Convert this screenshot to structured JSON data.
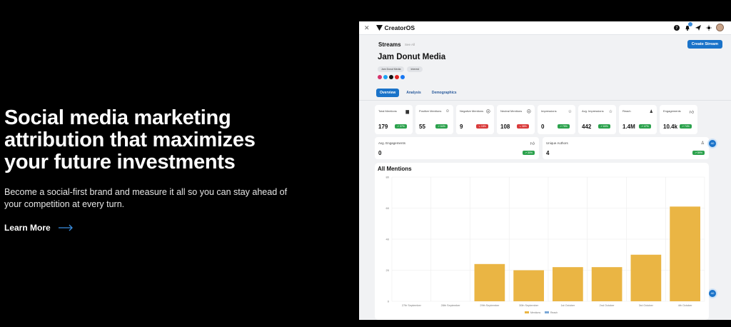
{
  "hero": {
    "headline": "Social media marketing attribution that maximizes your future investments",
    "subtext": "Become a social-first brand and measure it all so you can stay ahead of your competition at every turn.",
    "cta": "Learn More"
  },
  "app": {
    "brand": "CreatorOS",
    "section": "Streams",
    "see_all": "See All",
    "create_button": "Create Stream",
    "stream_name": "Jam Donut Media",
    "tags": [
      "Jam Donut Media",
      "Interest"
    ],
    "tabs": [
      "Overview",
      "Analysis",
      "Demographics"
    ],
    "active_tab": "Overview",
    "metrics": [
      {
        "label": "Total Mentions",
        "value": "179",
        "change": "37%",
        "trend": "up",
        "icon": "chat-icon"
      },
      {
        "label": "Positive Mentions",
        "value": "55",
        "change": "64%",
        "trend": "up",
        "icon": "smile-icon"
      },
      {
        "label": "Negative Mentions",
        "value": "9",
        "change": "18%",
        "trend": "down",
        "icon": "frown-icon"
      },
      {
        "label": "Neutral Mentions",
        "value": "108",
        "change": "38%",
        "trend": "down",
        "icon": "neutral-face-icon"
      },
      {
        "label": "Impressions",
        "value": "0",
        "change": "75%",
        "trend": "up",
        "icon": "star-icon"
      },
      {
        "label": "Avg. Impressions",
        "value": "442",
        "change": "60%",
        "trend": "up",
        "icon": "star-icon"
      },
      {
        "label": "Reach",
        "value": "1.4M",
        "change": "47%",
        "trend": "up",
        "icon": "user-plus-icon"
      },
      {
        "label": "Engagements",
        "value": "10.4k",
        "change": "74%",
        "trend": "up",
        "icon": "thumbs-up-icon"
      }
    ],
    "metrics2": [
      {
        "label": "Avg. Engagements",
        "value": "0",
        "change": "30%",
        "trend": "up",
        "icon": "thumbs-up-icon"
      },
      {
        "label": "Unique Authors",
        "value": "4",
        "change": "59%",
        "trend": "up",
        "icon": "user-icon"
      }
    ],
    "fab_label": "AD"
  },
  "chart_data": {
    "type": "bar",
    "title": "All Mentions",
    "categories": [
      "27th September",
      "28th September",
      "29th September",
      "30th September",
      "1st October",
      "2nd October",
      "3rd October",
      "4th October"
    ],
    "series": [
      {
        "name": "Mentions",
        "values": [
          0,
          0,
          24,
          20,
          22,
          22,
          30,
          61
        ],
        "color": "#eab544"
      },
      {
        "name": "Reach",
        "values": [
          0,
          0,
          0,
          0,
          0,
          0,
          0,
          0
        ],
        "color": "#7aa7d6"
      }
    ],
    "yticks": [
      0,
      20,
      40,
      60,
      80
    ],
    "ylim": [
      0,
      80
    ],
    "grid": true,
    "legend": "bottom"
  },
  "colors": {
    "accent": "#1a73c9",
    "bar": "#eab544",
    "up": "#2ca24d",
    "down": "#d93a3a"
  }
}
